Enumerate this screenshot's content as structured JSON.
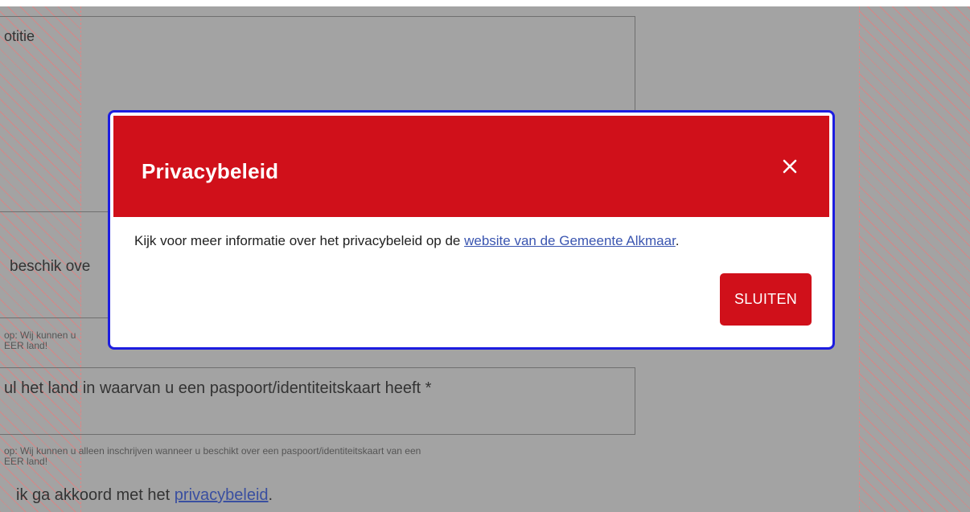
{
  "background": {
    "field_label_note": "otitie",
    "field_partial_text": "beschik ove",
    "hint1_line1": "op: Wij kunnen u",
    "hint1_line2": "EER land!",
    "country_label": "ul het land in waarvan u een paspoort/identiteitskaart heeft *",
    "hint2_line1": "op: Wij kunnen u alleen inschrijven wanneer u beschikt over een paspoort/identiteitskaart van een",
    "hint2_line2": "EER land!",
    "consent_prefix": "ik ga akkoord met het ",
    "consent_link": "privacybeleid",
    "consent_suffix": "."
  },
  "modal": {
    "title": "Privacybeleid",
    "close_label": "×",
    "body_prefix": "Kijk voor meer informatie over het privacybeleid op de ",
    "body_link": "website van de Gemeente Alkmaar",
    "body_suffix": ".",
    "button_label": "SLUITEN"
  },
  "colors": {
    "accent_red": "#d0101a",
    "modal_border": "#1d1de0",
    "link_blue": "#3a55b0",
    "overlay_gray": "#a3a3a3"
  }
}
